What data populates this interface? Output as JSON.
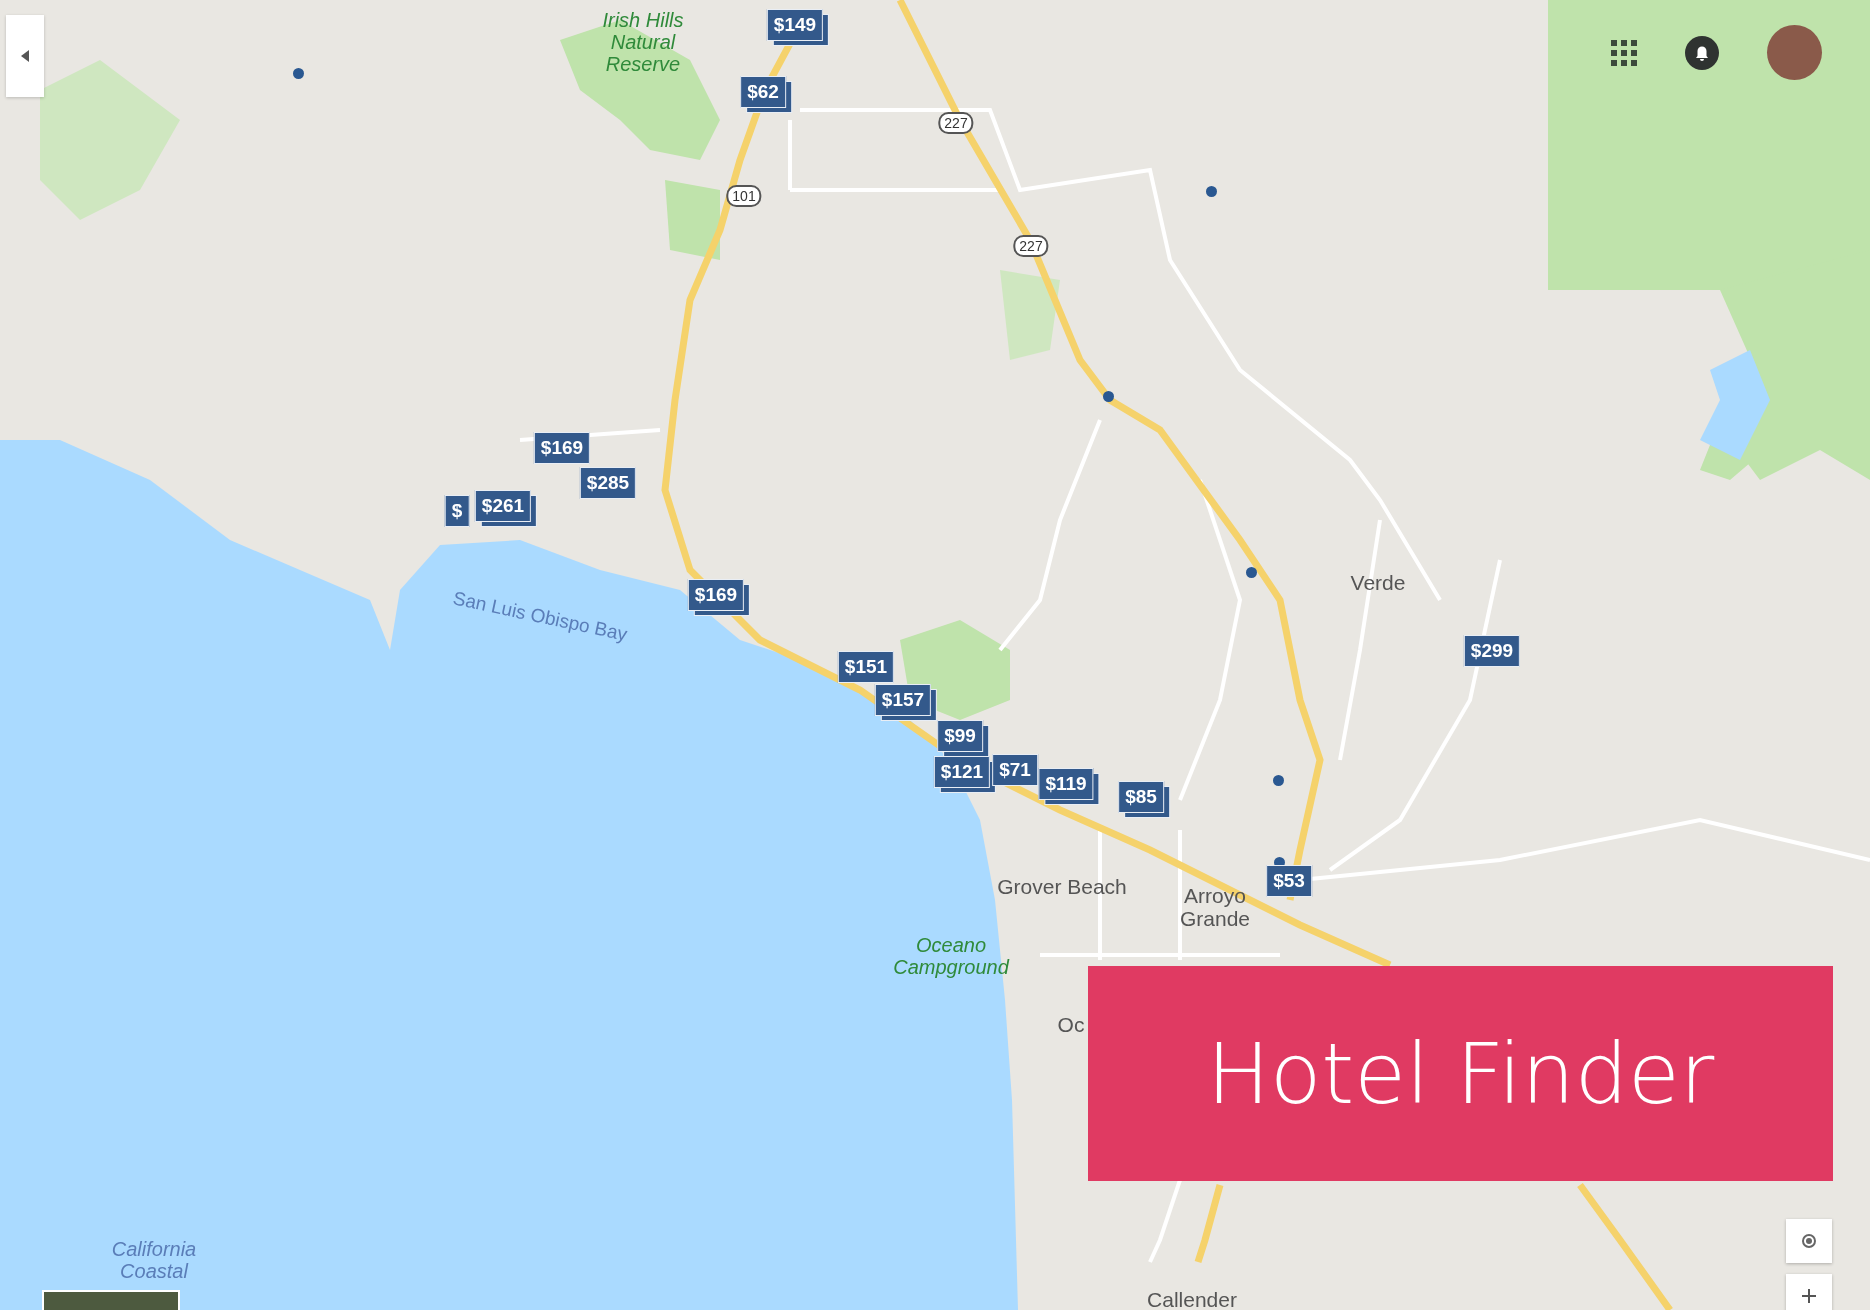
{
  "place_labels": [
    {
      "text": "Irish Hills\nNatural\nReserve",
      "kind": "park"
    },
    {
      "text": "San Luis Obispo Bay",
      "kind": "water"
    },
    {
      "text": "Verde",
      "kind": "town"
    },
    {
      "text": "Grover Beach",
      "kind": "town"
    },
    {
      "text": "Arroyo\nGrande",
      "kind": "town"
    },
    {
      "text": "Oceano\nCampground",
      "kind": "park"
    },
    {
      "text": "Oc",
      "kind": "town"
    },
    {
      "text": "California\nCoastal",
      "kind": "water"
    },
    {
      "text": "Callender",
      "kind": "town"
    }
  ],
  "route_shields": [
    {
      "text": "227"
    },
    {
      "text": "227"
    },
    {
      "text": "101"
    }
  ],
  "price_pins": [
    {
      "text": "$149",
      "stacked": true
    },
    {
      "text": "$62",
      "stacked": true
    },
    {
      "text": "$169",
      "stacked": false
    },
    {
      "text": "$285",
      "stacked": false
    },
    {
      "text": "$",
      "stacked": false
    },
    {
      "text": "$261",
      "stacked": true
    },
    {
      "text": "$169",
      "stacked": true
    },
    {
      "text": "$151",
      "stacked": false
    },
    {
      "text": "$157",
      "stacked": true
    },
    {
      "text": "$99",
      "stacked": true
    },
    {
      "text": "$121",
      "stacked": true
    },
    {
      "text": "$71",
      "stacked": false
    },
    {
      "text": "$119",
      "stacked": true
    },
    {
      "text": "$85",
      "stacked": true
    },
    {
      "text": "$53",
      "stacked": false
    },
    {
      "text": "$299",
      "stacked": false
    }
  ],
  "banner": {
    "title": "Hotel Finder"
  }
}
